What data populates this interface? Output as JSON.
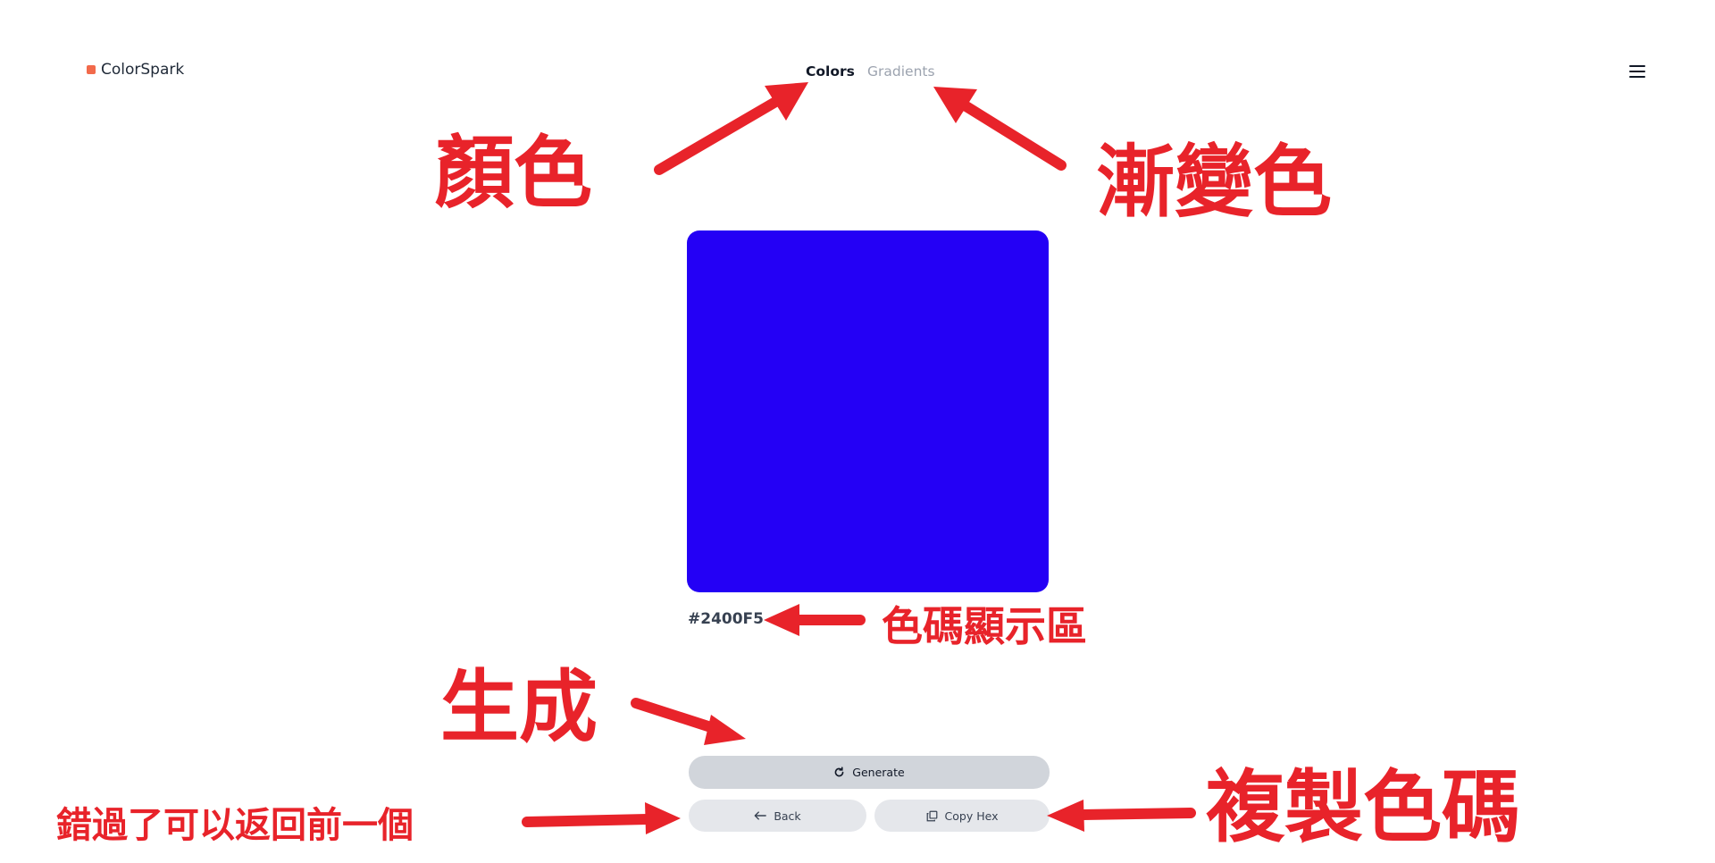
{
  "header": {
    "logo_text": "ColorSpark",
    "nav": {
      "colors_label": "Colors",
      "gradients_label": "Gradients"
    },
    "menu_icon": "hamburger-icon"
  },
  "swatch": {
    "color": "#2400F5",
    "hex_label": "#2400F5"
  },
  "buttons": {
    "generate_label": "Generate",
    "generate_icon": "refresh-icon",
    "back_label": "Back",
    "back_icon": "arrow-left-icon",
    "copy_label": "Copy Hex",
    "copy_icon": "copy-icon"
  },
  "annotations": {
    "colors": "顏色",
    "gradients": "漸變色",
    "hex_area": "色碼顯示區",
    "generate": "生成",
    "back": "錯過了可以返回前一個",
    "copy": "複製色碼"
  },
  "colors": {
    "accent": "#F26A4B",
    "annotation": "#E8232A",
    "generate_bg": "#D1D5DB",
    "secondary_bg": "#E5E7EB"
  }
}
